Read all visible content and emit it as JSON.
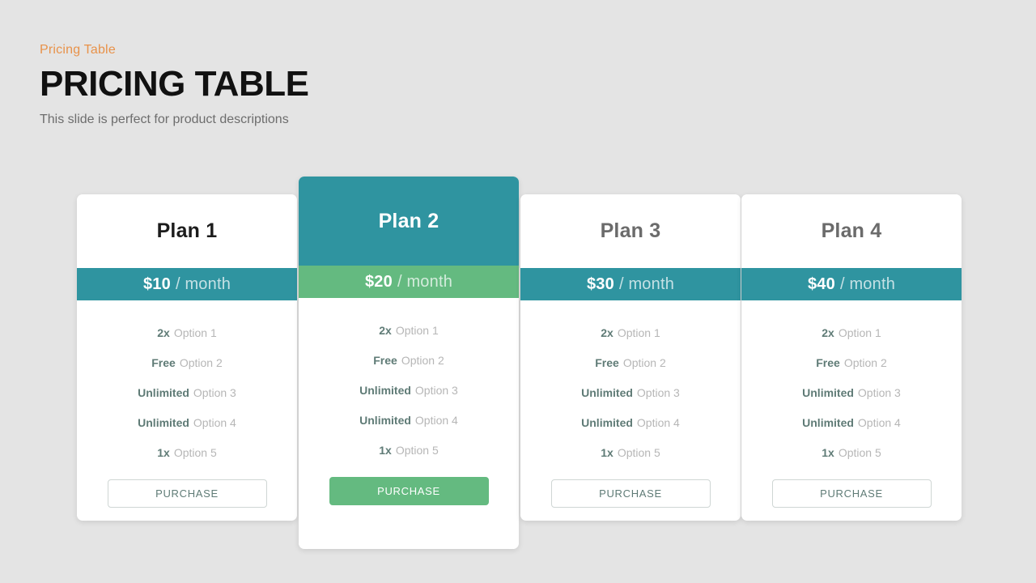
{
  "header": {
    "eyebrow": "Pricing Table",
    "title": "PRICING TABLE",
    "subtitle": "This slide is perfect for product descriptions"
  },
  "theme": {
    "background": "#e4e4e4",
    "accent_orange": "#e8924a",
    "teal": "#2f94a0",
    "green": "#64ba80",
    "muted_text": "#b6b6b6",
    "qty_text": "#5f7b76"
  },
  "plans": [
    {
      "name": "Plan 1",
      "price_amount": "$10",
      "price_period": "/ month",
      "highlighted": false,
      "features": [
        {
          "qty": "2x",
          "label": "Option 1"
        },
        {
          "qty": "Free",
          "label": "Option 2"
        },
        {
          "qty": "Unlimited",
          "label": "Option 3"
        },
        {
          "qty": "Unlimited",
          "label": "Option 4"
        },
        {
          "qty": "1x",
          "label": "Option 5"
        }
      ],
      "button_label": "PURCHASE"
    },
    {
      "name": "Plan 2",
      "price_amount": "$20",
      "price_period": "/ month",
      "highlighted": true,
      "features": [
        {
          "qty": "2x",
          "label": "Option 1"
        },
        {
          "qty": "Free",
          "label": "Option 2"
        },
        {
          "qty": "Unlimited",
          "label": "Option 3"
        },
        {
          "qty": "Unlimited",
          "label": "Option 4"
        },
        {
          "qty": "1x",
          "label": "Option 5"
        }
      ],
      "button_label": "PURCHASE"
    },
    {
      "name": "Plan 3",
      "price_amount": "$30",
      "price_period": "/ month",
      "highlighted": false,
      "features": [
        {
          "qty": "2x",
          "label": "Option 1"
        },
        {
          "qty": "Free",
          "label": "Option 2"
        },
        {
          "qty": "Unlimited",
          "label": "Option 3"
        },
        {
          "qty": "Unlimited",
          "label": "Option 4"
        },
        {
          "qty": "1x",
          "label": "Option 5"
        }
      ],
      "button_label": "PURCHASE"
    },
    {
      "name": "Plan 4",
      "price_amount": "$40",
      "price_period": "/ month",
      "highlighted": false,
      "features": [
        {
          "qty": "2x",
          "label": "Option 1"
        },
        {
          "qty": "Free",
          "label": "Option 2"
        },
        {
          "qty": "Unlimited",
          "label": "Option 3"
        },
        {
          "qty": "Unlimited",
          "label": "Option 4"
        },
        {
          "qty": "1x",
          "label": "Option 5"
        }
      ],
      "button_label": "PURCHASE"
    }
  ]
}
